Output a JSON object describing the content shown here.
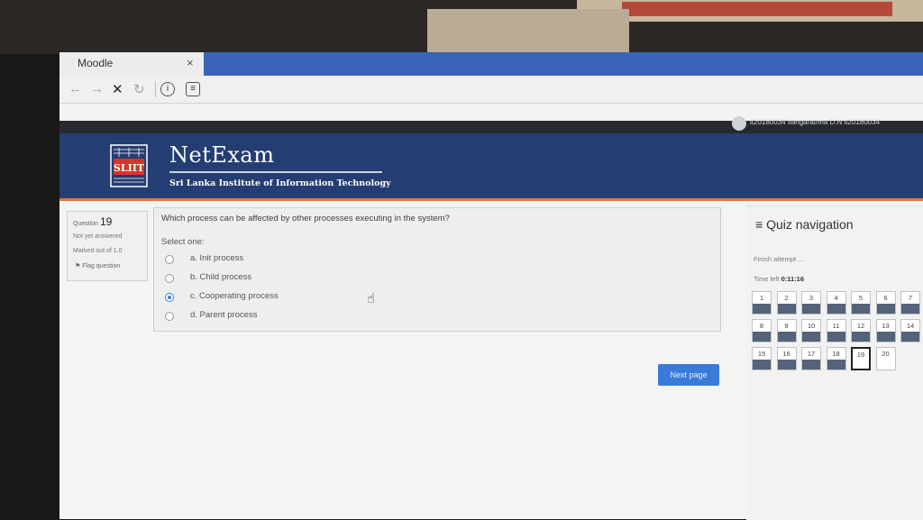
{
  "browser": {
    "tab_title": "Moodle",
    "tab_close": "×",
    "nav_back": "←",
    "nav_forward": "→",
    "nav_stop": "✕",
    "nav_reload": "↻",
    "nav_info": "i",
    "nav_page": "≡"
  },
  "user": {
    "name": "it20180034 Ilangarathna D.N it20180034"
  },
  "header": {
    "brand": "NetExam",
    "subtitle": "Sri Lanka Institute of Information Technology",
    "logo_text": "SLIIT"
  },
  "question_info": {
    "label": "Question",
    "number": "19",
    "state": "Not yet answered",
    "marks": "Marked out of 1.0",
    "flag": "Flag question"
  },
  "question": {
    "text": "Which process can be affected by other processes executing in the system?",
    "prompt": "Select one:",
    "options": [
      {
        "label": "a. Init process",
        "selected": false
      },
      {
        "label": "b. Child process",
        "selected": false
      },
      {
        "label": "c. Cooperating process",
        "selected": true
      },
      {
        "label": "d. Parent process",
        "selected": false
      }
    ]
  },
  "actions": {
    "next": "Next page"
  },
  "quiz_nav": {
    "title": "Quiz navigation",
    "finish": "Finish attempt ...",
    "time_label": "Time left",
    "time_value": "0:11:16",
    "current": 19,
    "answered_count": 18,
    "buttons": [
      "1",
      "2",
      "3",
      "4",
      "5",
      "6",
      "7",
      "8",
      "9",
      "10",
      "11",
      "12",
      "13",
      "14",
      "15",
      "16",
      "17",
      "18",
      "19",
      "20"
    ]
  },
  "colors": {
    "header_bg": "#243d73",
    "accent_orange": "#e8772e",
    "button_blue": "#3b7bd8",
    "answered_fill": "#55637a"
  }
}
